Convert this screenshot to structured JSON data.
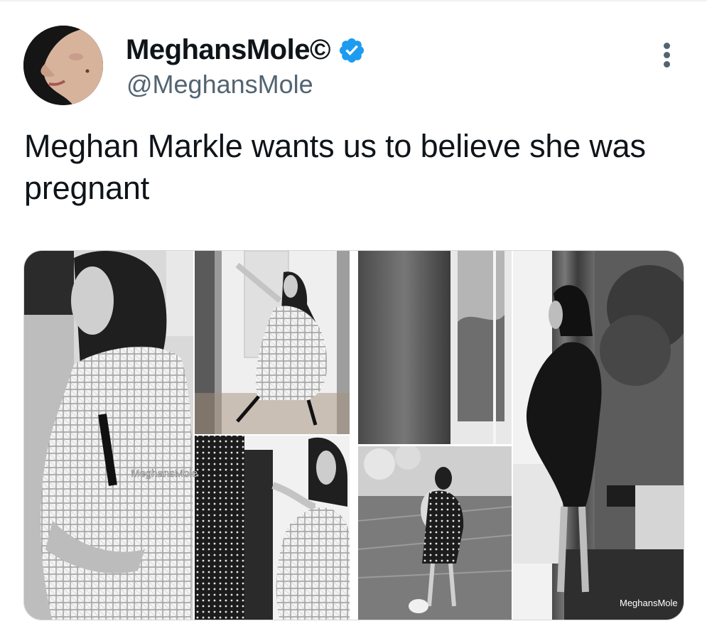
{
  "tweet": {
    "display_name": "MeghansMole©",
    "handle": "@MeghansMole",
    "verified": true,
    "text": "Meghan Markle wants us to believe she was pregnant"
  },
  "media": {
    "watermark_1": "MeghansMole",
    "watermark_2": "MeghansMole"
  },
  "icons": {
    "verified": "verified-badge-icon",
    "more": "more-options-icon"
  },
  "colors": {
    "verified_blue": "#1d9bf0",
    "text_primary": "#0f1419",
    "text_secondary": "#536471"
  }
}
